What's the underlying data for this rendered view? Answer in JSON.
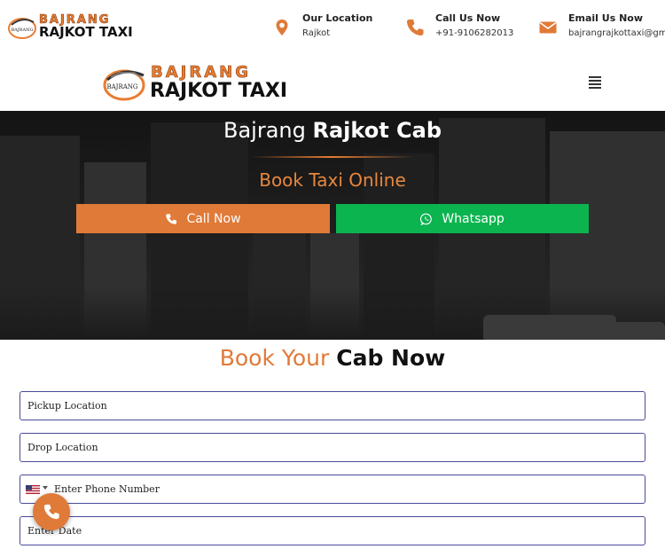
{
  "brand": {
    "line1": "BAJRANG",
    "line2": "RAJKOT TAXI",
    "emblem_text": "BAJRANG"
  },
  "topbar": {
    "location": {
      "title": "Our Location",
      "value": "Rajkot",
      "icon": "map-pin-icon"
    },
    "call": {
      "title": "Call Us Now",
      "value": "+91-9106282013",
      "icon": "phone-icon"
    },
    "email": {
      "title": "Email Us Now",
      "value": "bajrangrajkottaxi@gma",
      "icon": "envelope-icon"
    }
  },
  "header": {
    "menu_icon": "hamburger-menu-icon"
  },
  "hero": {
    "title_light": "Bajrang",
    "title_bold": "Rajkot Cab",
    "subtitle": "Book Taxi Online",
    "call_label": "Call Now",
    "whatsapp_label": "Whatsapp"
  },
  "booking": {
    "title_light": "Book Your",
    "title_bold": "Cab Now",
    "pickup_placeholder": "Pickup Location",
    "drop_placeholder": "Drop Location",
    "phone_placeholder": "Enter Phone Number",
    "date_placeholder": "Enter Date",
    "phone_country": "US"
  },
  "colors": {
    "accent": "#e07a38",
    "whatsapp": "#0cb44f",
    "field_border": "#4a4a9a"
  }
}
